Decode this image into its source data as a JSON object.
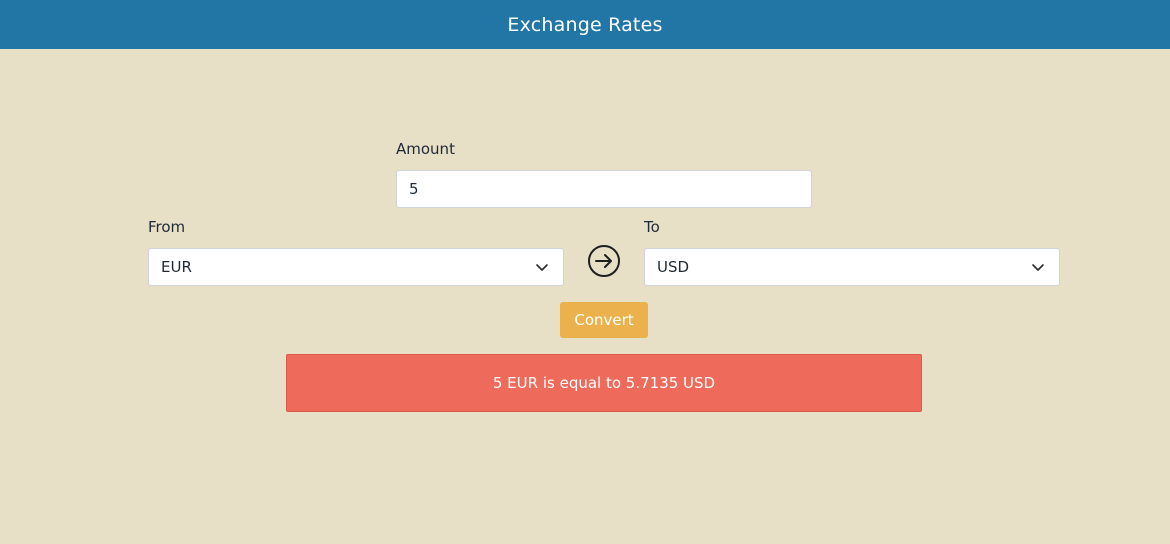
{
  "header": {
    "title": "Exchange Rates"
  },
  "amount": {
    "label": "Amount",
    "value": "5"
  },
  "from": {
    "label": "From",
    "selected": "EUR"
  },
  "to": {
    "label": "To",
    "selected": "USD"
  },
  "convert_button": {
    "label": "Convert"
  },
  "result": {
    "text": "5 EUR is equal to 5.7135 USD"
  },
  "colors": {
    "header_bg": "#2176a6",
    "page_bg": "#e7dfc6",
    "convert_bg": "#eab14d",
    "result_bg": "#ee6a5b"
  },
  "icons": {
    "swap": "arrow-right-circle-icon",
    "dropdown": "chevron-down-icon"
  }
}
